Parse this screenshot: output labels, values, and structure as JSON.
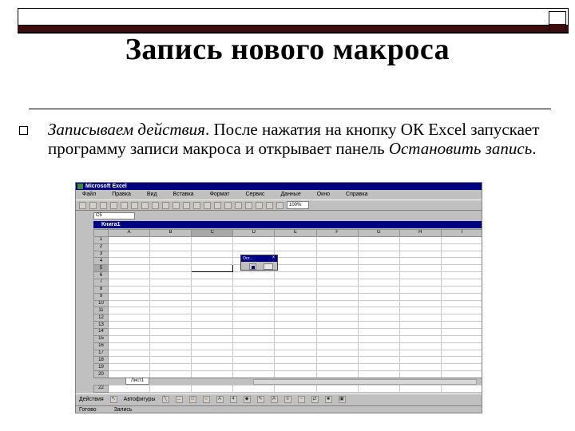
{
  "slide": {
    "title": "Запись нового макроса",
    "body_italic_1": "Записываем действия",
    "body_plain_1": ". После нажатия на кнопку ОК  Excel запускает программу записи макроса и открывает панель ",
    "body_italic_2": "Остановить запись",
    "body_plain_2": "."
  },
  "excel": {
    "window_title": "Microsoft Excel",
    "menu": [
      "Файл",
      "Правка",
      "Вид",
      "Вставка",
      "Формат",
      "Сервис",
      "Данные",
      "Окно",
      "Справка"
    ],
    "zoom": "100%",
    "namebox": "C5",
    "book_title": "Книга1",
    "columns": [
      "A",
      "B",
      "C",
      "D",
      "E",
      "F",
      "G",
      "H",
      "I"
    ],
    "rows": [
      "1",
      "2",
      "3",
      "4",
      "5",
      "6",
      "7",
      "8",
      "9",
      "10",
      "11",
      "12",
      "13",
      "14",
      "15",
      "16",
      "17",
      "18",
      "19",
      "20",
      "21",
      "22"
    ],
    "sheet_tab": "Лист1",
    "draw_label": "Действия",
    "autoshapes_label": "Автофигуры",
    "status_ready": "Готово",
    "status_recording": "Запись",
    "stop_panel_title": "Ост...",
    "stop_panel_close": "×"
  }
}
